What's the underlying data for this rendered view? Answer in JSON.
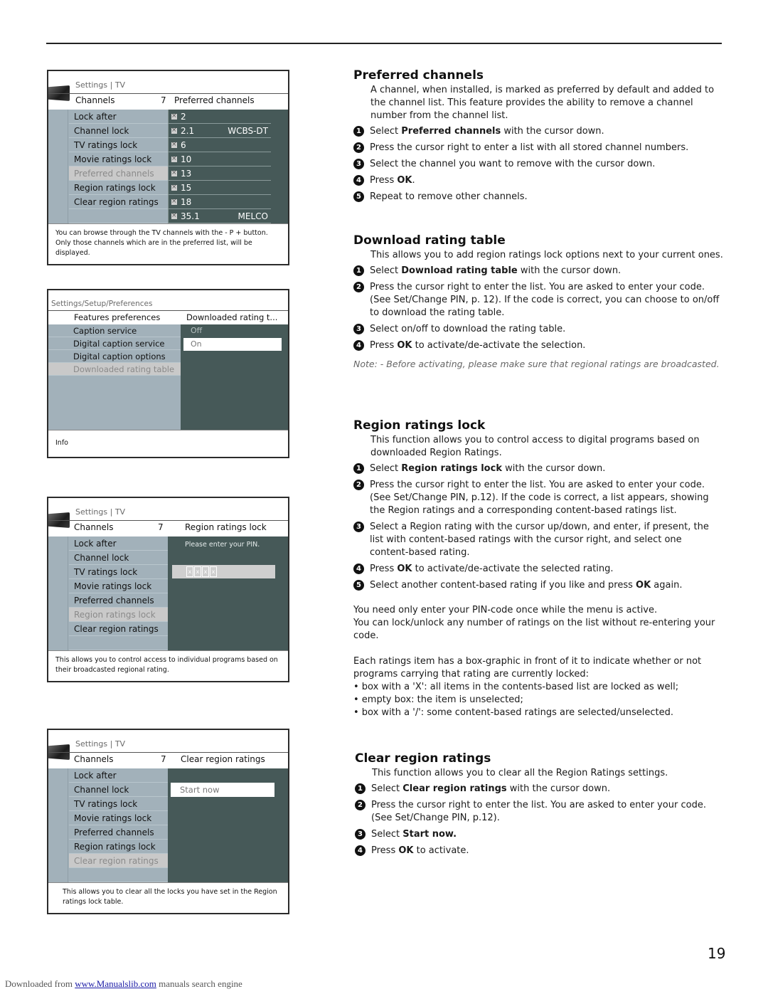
{
  "page": {
    "number": "19",
    "footer": {
      "prefix": "Downloaded from",
      "link": "www.Manualslib.com",
      "suffix": "manuals search engine"
    }
  },
  "menus": {
    "preferred": {
      "breadcrumb": "Settings | TV",
      "sub_left": "Channels",
      "sub_num": "7",
      "sub_right": "Preferred channels",
      "items": [
        "Lock after",
        "Channel lock",
        "TV ratings lock",
        "Movie ratings lock",
        "Preferred channels",
        "Region ratings lock",
        "Clear region ratings",
        ""
      ],
      "selected_index": 4,
      "channels": [
        {
          "num": "2",
          "name": ""
        },
        {
          "num": "2.1",
          "name": "WCBS-DT"
        },
        {
          "num": "6",
          "name": ""
        },
        {
          "num": "10",
          "name": ""
        },
        {
          "num": "13",
          "name": ""
        },
        {
          "num": "15",
          "name": ""
        },
        {
          "num": "18",
          "name": ""
        },
        {
          "num": "35.1",
          "name": "MELCO"
        }
      ],
      "footer": "You can browse through the TV channels with the - P + button. Only those channels which are in the preferred list, will be displayed."
    },
    "download": {
      "breadcrumb": "Settings/Setup/Preferences",
      "sub_left": "Features preferences",
      "sub_right": "Downloaded rating t...",
      "items": [
        "Caption service",
        "Digital caption service",
        "Digital caption options",
        "Downloaded rating table"
      ],
      "selected_index": 3,
      "options": [
        "Off",
        "On"
      ],
      "selected_option": "On",
      "footer": "Info"
    },
    "region": {
      "breadcrumb": "Settings | TV",
      "sub_left": "Channels",
      "sub_num": "7",
      "sub_right": "Region ratings lock",
      "items": [
        "Lock after",
        "Channel lock",
        "TV ratings lock",
        "Movie ratings lock",
        "Preferred channels",
        "Region ratings lock",
        "Clear region ratings",
        ""
      ],
      "selected_index": 5,
      "pin_prompt": "Please enter your PIN.",
      "pin_digits": [
        "x",
        "x",
        "x",
        "x"
      ],
      "footer": "This allows you to control access to individual programs based on their broadcasted regional rating."
    },
    "clear": {
      "breadcrumb": "Settings | TV",
      "sub_left": "Channels",
      "sub_num": "7",
      "sub_right": "Clear region ratings",
      "items": [
        "Lock after",
        "Channel lock",
        "TV ratings lock",
        "Movie ratings lock",
        "Preferred channels",
        "Region ratings lock",
        "Clear region ratings",
        ""
      ],
      "selected_index": 6,
      "button": "Start now",
      "footer": "This allows you to clear all the locks you have set in the Region ratings lock table."
    }
  },
  "sections": {
    "preferred": {
      "title": "Preferred channels",
      "intro": "A channel, when installed, is marked as preferred by default and added to the channel list. This feature provides the ability to remove a channel number from the channel list.",
      "steps": [
        {
          "pre": "Select ",
          "bold": "Preferred channels",
          "post": " with the cursor down."
        },
        {
          "pre": "Press the cursor right to enter a list with all stored channel numbers.",
          "bold": "",
          "post": ""
        },
        {
          "pre": "Select the channel you want to remove with the cursor down.",
          "bold": "",
          "post": ""
        },
        {
          "pre": "Press ",
          "bold": "OK",
          "post": "."
        },
        {
          "pre": "Repeat to remove other channels.",
          "bold": "",
          "post": ""
        }
      ]
    },
    "download": {
      "title": "Download rating table",
      "intro": "This allows you to add region ratings lock options next to your current ones.",
      "steps": [
        {
          "pre": "Select ",
          "bold": "Download rating table",
          "post": " with the cursor down."
        },
        {
          "pre": "Press the cursor right to enter the list. You are asked to enter your code. (See Set/Change PIN, p. 12).  If the code is correct, you can choose to on/off to download the rating table.",
          "bold": "",
          "post": ""
        },
        {
          "pre": "Select on/off to download the rating table.",
          "bold": "",
          "post": ""
        },
        {
          "pre": "Press ",
          "bold": "OK",
          "post": " to activate/de-activate the selection."
        }
      ],
      "note": "Note: - Before activating, please make sure that regional ratings are broadcasted."
    },
    "region": {
      "title": "Region ratings lock",
      "intro": "This function allows you to control access to digital programs based on downloaded Region Ratings.",
      "steps": [
        {
          "pre": "Select ",
          "bold": "Region ratings lock",
          "post": " with the cursor down."
        },
        {
          "pre": "Press the cursor right to enter the list. You are asked to enter your code. (See Set/Change PIN, p.12).  If the code is correct, a list appears, showing the Region ratings and a corresponding content-based ratings list.",
          "bold": "",
          "post": ""
        },
        {
          "pre": "Select a Region rating with the cursor up/down, and enter, if present, the list with content-based ratings with the cursor right, and select one content-based rating.",
          "bold": "",
          "post": ""
        },
        {
          "pre": "Press ",
          "bold": "OK",
          "post": " to activate/de-activate the selected rating."
        },
        {
          "pre": "Select another content-based rating if you like and press ",
          "bold": "OK",
          "post": " again."
        }
      ],
      "para1": "You need only enter your PIN-code once while the menu is active.",
      "para2": "You can lock/unlock any number of ratings on the list without re-entering your code.",
      "para3": "Each ratings item has a box-graphic in front of it to indicate whether or not programs carrying that rating are currently locked:",
      "bullets": [
        "• box with a 'X': all items in the contents-based list are locked as well;",
        "• empty box: the item is unselected;",
        "• box with a '/': some content-based ratings are selected/unselected."
      ]
    },
    "clear": {
      "title": "Clear region ratings",
      "intro": "This function allows you to clear all the Region Ratings settings.",
      "steps": [
        {
          "pre": "Select ",
          "bold": "Clear region ratings",
          "post": " with the cursor down."
        },
        {
          "pre": "Press the cursor right to enter the list. You are asked to enter your code. (See Set/Change PIN, p.12).",
          "bold": "",
          "post": ""
        },
        {
          "pre": "Select ",
          "bold": "Start now.",
          "post": ""
        },
        {
          "pre": "Press ",
          "bold": "OK",
          "post": " to activate."
        }
      ]
    }
  }
}
